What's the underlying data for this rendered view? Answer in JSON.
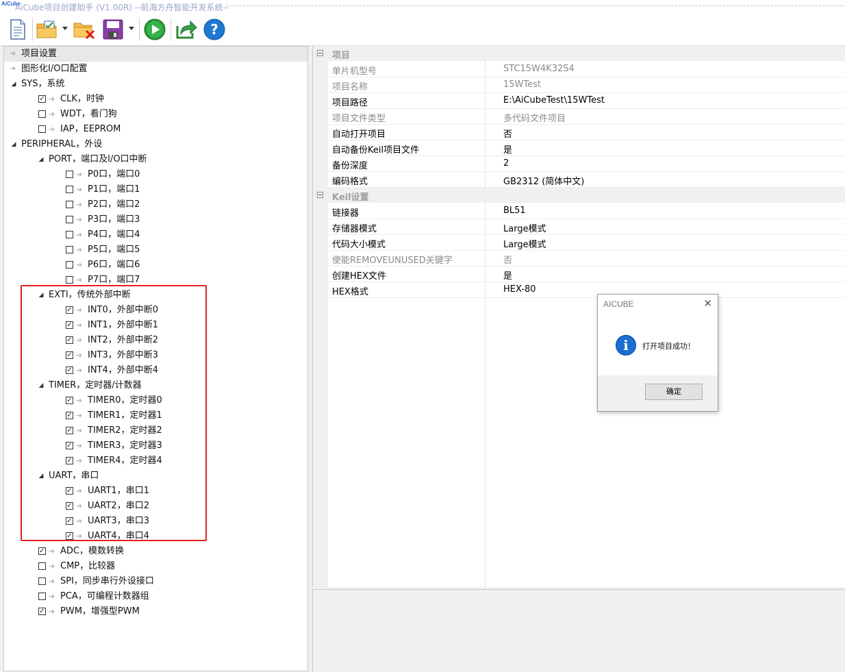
{
  "window": {
    "title": "AiCube项目创建助手 (V1.00R) --前海方舟智能开发系统--",
    "logo_text": "AiCube"
  },
  "toolbar": {
    "buttons": [
      {
        "name": "new-project-icon"
      },
      {
        "name": "open-project-icon"
      },
      {
        "name": "close-project-icon"
      },
      {
        "name": "save-project-icon"
      },
      {
        "name": "run-icon"
      },
      {
        "name": "export-icon"
      },
      {
        "name": "help-icon"
      }
    ],
    "help_glyph": "?"
  },
  "tree": {
    "items": [
      {
        "label": "项目设置",
        "level": 0,
        "type": "arrow"
      },
      {
        "label": "图形化I/O口配置",
        "level": 0,
        "type": "arrow"
      },
      {
        "label": "SYS，系统",
        "level": 0,
        "type": "expanded"
      },
      {
        "label": "CLK，时钟",
        "level": 1,
        "type": "check",
        "checked": true
      },
      {
        "label": "WDT，看门狗",
        "level": 1,
        "type": "check",
        "checked": false
      },
      {
        "label": "IAP，EEPROM",
        "level": 1,
        "type": "check",
        "checked": false
      },
      {
        "label": "PERIPHERAL，外设",
        "level": 0,
        "type": "expanded"
      },
      {
        "label": "PORT，端口及I/O口中断",
        "level": 1,
        "type": "expanded"
      },
      {
        "label": "P0口，端口0",
        "level": 2,
        "type": "check",
        "checked": false
      },
      {
        "label": "P1口，端口1",
        "level": 2,
        "type": "check",
        "checked": false
      },
      {
        "label": "P2口，端口2",
        "level": 2,
        "type": "check",
        "checked": false
      },
      {
        "label": "P3口，端口3",
        "level": 2,
        "type": "check",
        "checked": false
      },
      {
        "label": "P4口，端口4",
        "level": 2,
        "type": "check",
        "checked": false
      },
      {
        "label": "P5口，端口5",
        "level": 2,
        "type": "check",
        "checked": false
      },
      {
        "label": "P6口，端口6",
        "level": 2,
        "type": "check",
        "checked": false
      },
      {
        "label": "P7口，端口7",
        "level": 2,
        "type": "check",
        "checked": false
      },
      {
        "label": "EXTI，传统外部中断",
        "level": 1,
        "type": "expanded"
      },
      {
        "label": "INT0，外部中断0",
        "level": 2,
        "type": "check",
        "checked": true
      },
      {
        "label": "INT1，外部中断1",
        "level": 2,
        "type": "check",
        "checked": true
      },
      {
        "label": "INT2，外部中断2",
        "level": 2,
        "type": "check",
        "checked": true
      },
      {
        "label": "INT3，外部中断3",
        "level": 2,
        "type": "check",
        "checked": true
      },
      {
        "label": "INT4，外部中断4",
        "level": 2,
        "type": "check",
        "checked": true
      },
      {
        "label": "TIMER，定时器/计数器",
        "level": 1,
        "type": "expanded"
      },
      {
        "label": "TIMER0，定时器0",
        "level": 2,
        "type": "check",
        "checked": true
      },
      {
        "label": "TIMER1，定时器1",
        "level": 2,
        "type": "check",
        "checked": true
      },
      {
        "label": "TIMER2，定时器2",
        "level": 2,
        "type": "check",
        "checked": true
      },
      {
        "label": "TIMER3，定时器3",
        "level": 2,
        "type": "check",
        "checked": true
      },
      {
        "label": "TIMER4，定时器4",
        "level": 2,
        "type": "check",
        "checked": true
      },
      {
        "label": "UART，串口",
        "level": 1,
        "type": "expanded"
      },
      {
        "label": "UART1，串口1",
        "level": 2,
        "type": "check",
        "checked": true
      },
      {
        "label": "UART2，串口2",
        "level": 2,
        "type": "check",
        "checked": true
      },
      {
        "label": "UART3，串口3",
        "level": 2,
        "type": "check",
        "checked": true
      },
      {
        "label": "UART4，串口4",
        "level": 2,
        "type": "check",
        "checked": true
      },
      {
        "label": "ADC，模数转换",
        "level": 1,
        "type": "check",
        "checked": true
      },
      {
        "label": "CMP，比较器",
        "level": 1,
        "type": "check",
        "checked": false
      },
      {
        "label": "SPI，同步串行外设接口",
        "level": 1,
        "type": "check",
        "checked": false
      },
      {
        "label": "PCA，可编程计数器组",
        "level": 1,
        "type": "check",
        "checked": false
      },
      {
        "label": "PWM，增强型PWM",
        "level": 1,
        "type": "check",
        "checked": true
      }
    ],
    "highlight_color": "#e02020"
  },
  "properties": {
    "categories": [
      {
        "label": "项目",
        "rows": [
          {
            "name": "单片机型号",
            "value": "STC15W4K32S4",
            "readonly": true
          },
          {
            "name": "项目名称",
            "value": "15WTest",
            "readonly": true
          },
          {
            "name": "项目路径",
            "value": "E:\\AiCubeTest\\15WTest",
            "readonly": false
          },
          {
            "name": "项目文件类型",
            "value": "多代码文件项目",
            "readonly": true
          },
          {
            "name": "自动打开项目",
            "value": "否",
            "readonly": false
          },
          {
            "name": "自动备份Keil项目文件",
            "value": "是",
            "readonly": false
          },
          {
            "name": "备份深度",
            "value": "2",
            "readonly": false
          },
          {
            "name": "编码格式",
            "value": "GB2312 (简体中文)",
            "readonly": false
          }
        ]
      },
      {
        "label": "Keil设置",
        "rows": [
          {
            "name": "链接器",
            "value": "BL51",
            "readonly": false
          },
          {
            "name": "存储器模式",
            "value": "Large模式",
            "readonly": false
          },
          {
            "name": "代码大小模式",
            "value": "Large模式",
            "readonly": false
          },
          {
            "name": "使能REMOVEUNUSED关键字",
            "value": "否",
            "readonly": true
          },
          {
            "name": "创建HEX文件",
            "value": "是",
            "readonly": false
          },
          {
            "name": "HEX格式",
            "value": "HEX-80",
            "readonly": false
          }
        ]
      }
    ]
  },
  "dialog": {
    "title": "AICUBE",
    "close_glyph": "✕",
    "icon_glyph": "i",
    "message": "打开项目成功！",
    "ok_label": "确定"
  }
}
